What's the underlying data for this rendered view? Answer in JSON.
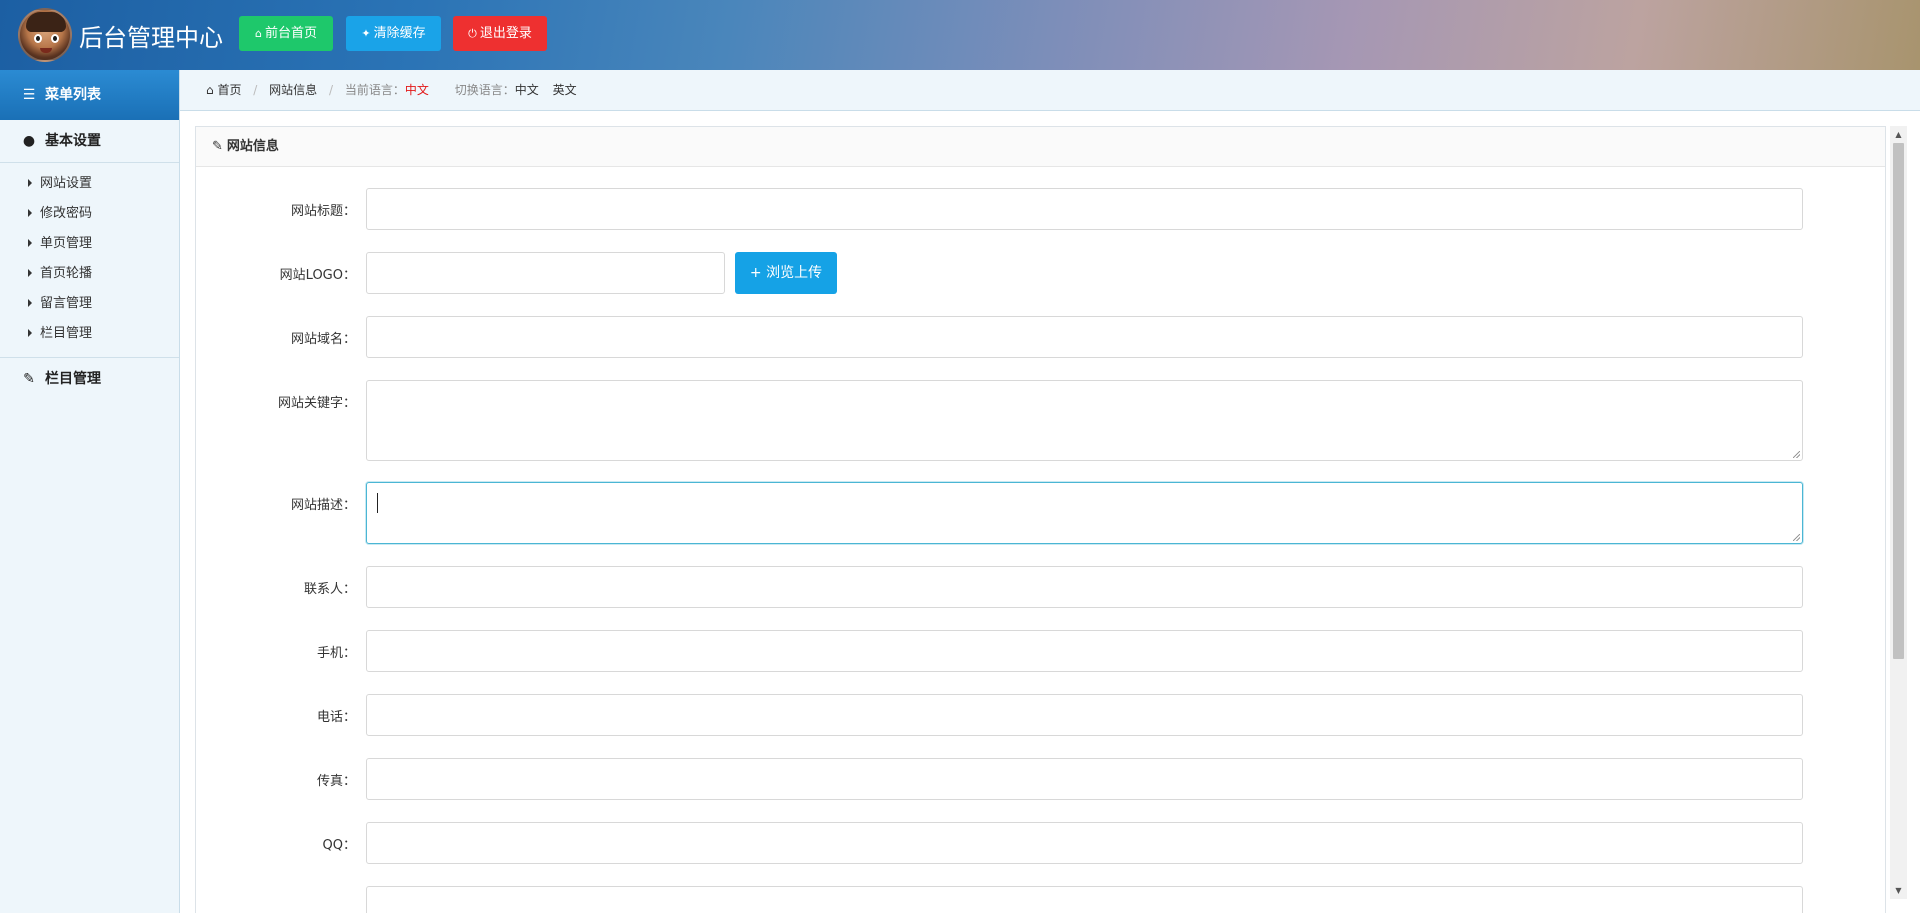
{
  "header": {
    "title": "后台管理中心",
    "buttons": {
      "home": {
        "icon": "home-icon",
        "label": "前台首页"
      },
      "cache": {
        "icon": "wrench-icon",
        "label": "清除缓存"
      },
      "logout": {
        "icon": "power-icon",
        "label": "退出登录"
      }
    }
  },
  "sidebar": {
    "menu_title": "菜单列表",
    "groups": [
      {
        "label": "基本设置",
        "icon": "user-icon",
        "items": [
          {
            "label": "网站设置"
          },
          {
            "label": "修改密码"
          },
          {
            "label": "单页管理"
          },
          {
            "label": "首页轮播"
          },
          {
            "label": "留言管理"
          },
          {
            "label": "栏目管理"
          }
        ]
      },
      {
        "label": "栏目管理",
        "icon": "edit-icon"
      }
    ]
  },
  "breadcrumb": {
    "home": "首页",
    "current": "网站信息",
    "lang_label": "当前语言：",
    "lang_value": "中文",
    "switch_label": "切换语言：",
    "options": [
      "中文",
      "英文"
    ]
  },
  "panel": {
    "title": "网站信息",
    "fields": [
      {
        "label": "网站标题：",
        "value": ""
      },
      {
        "label": "网站LOGO：",
        "value": "",
        "button": "+ 浏览上传"
      },
      {
        "label": "网站域名：",
        "value": ""
      },
      {
        "label": "网站关键字：",
        "value": ""
      },
      {
        "label": "网站描述：",
        "value": ""
      },
      {
        "label": "联系人：",
        "value": ""
      },
      {
        "label": "手机：",
        "value": ""
      },
      {
        "label": "电话：",
        "value": ""
      },
      {
        "label": "传真：",
        "value": ""
      },
      {
        "label": "QQ：",
        "value": ""
      }
    ]
  },
  "colors": {
    "btn_green": "#1ec86b",
    "btn_blue": "#1aa3e8",
    "btn_red": "#ee3030",
    "menu_head": "#1a70b6",
    "sidebar_bg": "#eef6fb",
    "lang_active": "#e21818",
    "focus_border": "#4bb6d4"
  }
}
